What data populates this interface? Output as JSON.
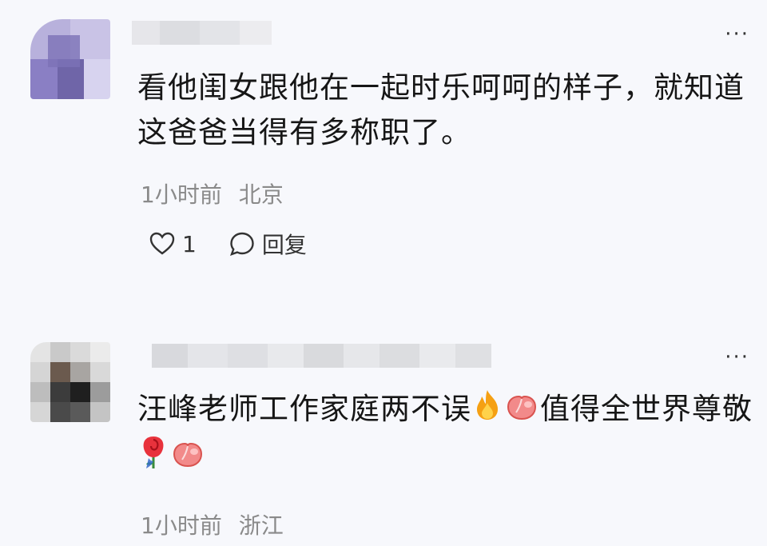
{
  "comments": [
    {
      "text": "看他闺女跟他在一起时乐呵呵的样子，就知道这爸爸当得有多称职了。",
      "time": "1小时前",
      "location": "北京",
      "like_count": "1",
      "reply_label": "回复",
      "more": "···"
    },
    {
      "text_a": "汪峰老师工作家庭两不误",
      "text_b": "值得全世界尊敬",
      "emojis": [
        "fire-emoji",
        "peach-emoji",
        "rose-emoji",
        "peach-emoji"
      ],
      "time": "1小时前",
      "location": "浙江",
      "more": "···"
    }
  ],
  "colors": {
    "background": "#f7f8fc",
    "text": "#161616",
    "meta": "#8a8a8a"
  }
}
